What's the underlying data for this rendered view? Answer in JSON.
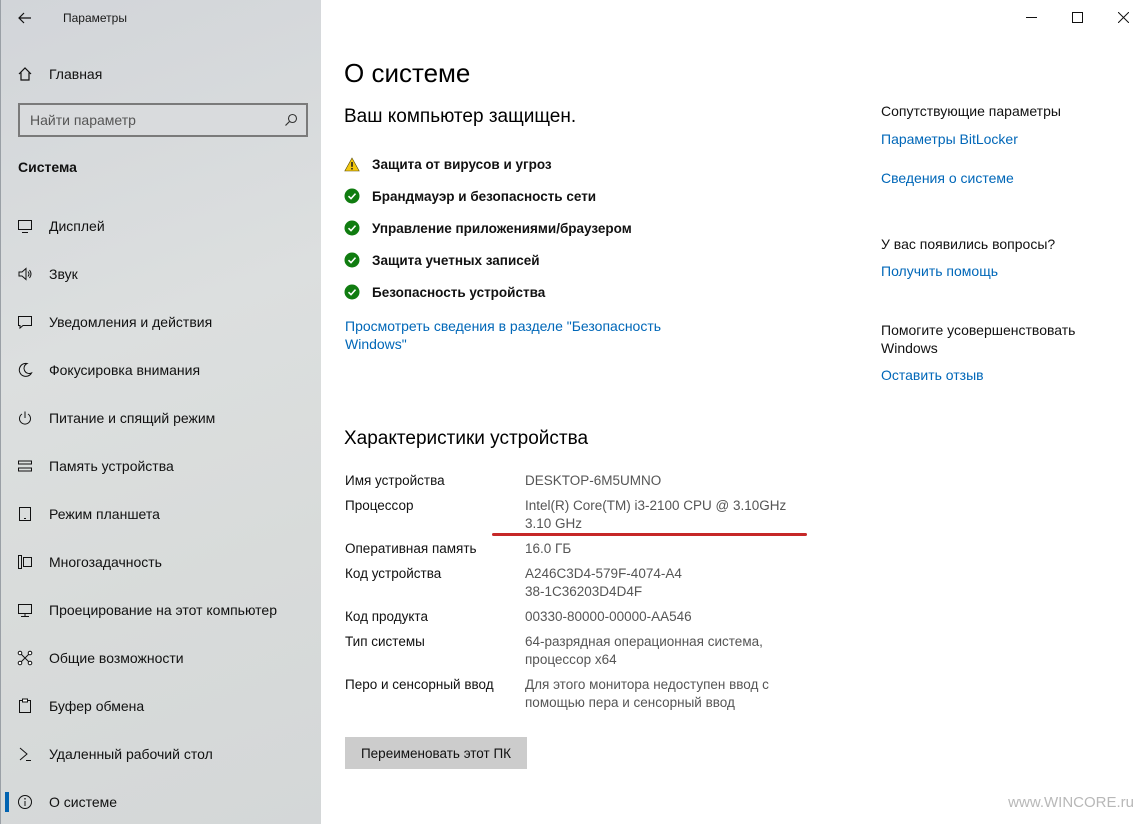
{
  "window": {
    "app_title": "Параметры"
  },
  "sidebar": {
    "home_label": "Главная",
    "search_placeholder": "Найти параметр",
    "section_heading": "Система",
    "items": [
      {
        "label": "Дисплей",
        "icon": "display-icon"
      },
      {
        "label": "Звук",
        "icon": "sound-icon"
      },
      {
        "label": "Уведомления и действия",
        "icon": "notifications-icon"
      },
      {
        "label": "Фокусировка внимания",
        "icon": "moon-icon"
      },
      {
        "label": "Питание и спящий режим",
        "icon": "power-icon"
      },
      {
        "label": "Память устройства",
        "icon": "storage-icon"
      },
      {
        "label": "Режим планшета",
        "icon": "tablet-icon"
      },
      {
        "label": "Многозадачность",
        "icon": "multitasking-icon"
      },
      {
        "label": "Проецирование на этот компьютер",
        "icon": "projecting-icon"
      },
      {
        "label": "Общие возможности",
        "icon": "shared-experiences-icon"
      },
      {
        "label": "Буфер обмена",
        "icon": "clipboard-icon"
      },
      {
        "label": "Удаленный рабочий стол",
        "icon": "remote-desktop-icon"
      },
      {
        "label": "О системе",
        "icon": "info-icon",
        "active": true
      }
    ]
  },
  "main": {
    "title": "О системе",
    "protected_heading": "Ваш компьютер защищен.",
    "security_items": [
      {
        "label": "Защита от вирусов и угроз",
        "status": "warning"
      },
      {
        "label": "Брандмауэр и безопасность сети",
        "status": "ok"
      },
      {
        "label": "Управление приложениями/браузером",
        "status": "ok"
      },
      {
        "label": "Защита учетных записей",
        "status": "ok"
      },
      {
        "label": "Безопасность устройства",
        "status": "ok"
      }
    ],
    "security_link": "Просмотреть сведения в разделе \"Безопасность Windows\"",
    "device_heading": "Характеристики устройства",
    "specs": {
      "device_name": {
        "key": "Имя устройства",
        "value": "DESKTOP-6M5UMNO"
      },
      "processor": {
        "key": "Процессор",
        "value": "Intel(R) Core(TM) i3-2100 CPU @ 3.10GHz 3.10 GHz"
      },
      "ram": {
        "key": "Оперативная память",
        "value": "16.0 ГБ"
      },
      "device_id": {
        "key": "Код устройства",
        "value": "A246C3D4-579F-4074-A438-1C36203D4D4F"
      },
      "product_id": {
        "key": "Код продукта",
        "value": "00330-80000-00000-AA546"
      },
      "system_type": {
        "key": "Тип системы",
        "value": "64-разрядная операционная система, процессор x64"
      },
      "pen_touch": {
        "key": "Перо и сенсорный ввод",
        "value": "Для этого монитора недоступен ввод с помощью пера и сенсорный ввод"
      }
    },
    "rename_button": "Переименовать этот ПК"
  },
  "related": {
    "heading": "Сопутствующие параметры",
    "bitlocker_link": "Параметры BitLocker",
    "system_info_link": "Сведения о системе",
    "questions_heading": "У вас появились вопросы?",
    "help_link": "Получить помощь",
    "improve_heading": "Помогите усовершенствовать Windows",
    "feedback_link": "Оставить отзыв"
  },
  "watermark": "www.WINCORE.ru",
  "colors": {
    "accent": "#0067b8",
    "ok_green": "#107c10",
    "warning_yellow": "#f2c811",
    "highlight_red": "#c62828"
  }
}
